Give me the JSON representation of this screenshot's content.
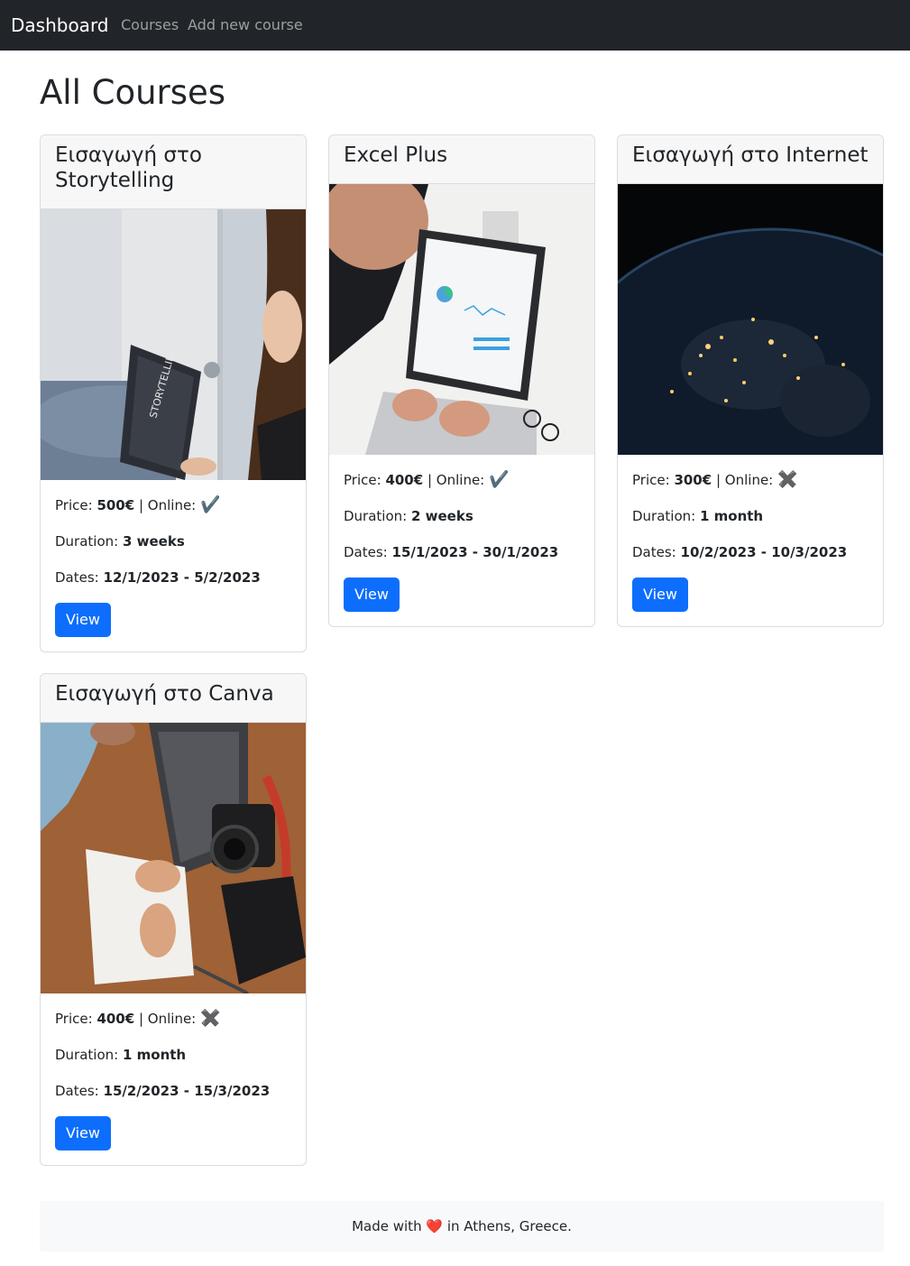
{
  "nav": {
    "brand": "Dashboard",
    "courses": "Courses",
    "add_course": "Add new course"
  },
  "page_title": "All Courses",
  "labels": {
    "price": "Price:",
    "online": "| Online:",
    "duration": "Duration:",
    "dates": "Dates:",
    "view": "View"
  },
  "courses": [
    {
      "title": "Εισαγωγή στο Storytelling",
      "image_text": "STORYTELLING",
      "price": "500€",
      "online_icon": "✔️",
      "duration": "3 weeks",
      "dates": "12/1/2023 - 5/2/2023"
    },
    {
      "title": "Excel Plus",
      "price": "400€",
      "online_icon": "✔️",
      "duration": "2 weeks",
      "dates": "15/1/2023 - 30/1/2023"
    },
    {
      "title": "Εισαγωγή στο Internet",
      "price": "300€",
      "online_icon": "✖️",
      "duration": "1 month",
      "dates": "10/2/2023 - 10/3/2023"
    },
    {
      "title": "Εισαγωγή στο Canva",
      "price": "400€",
      "online_icon": "✖️",
      "duration": "1 month",
      "dates": "15/2/2023 - 15/3/2023"
    }
  ],
  "footer": {
    "before": "Made with",
    "heart": "❤️",
    "after": "in Athens, Greece."
  }
}
